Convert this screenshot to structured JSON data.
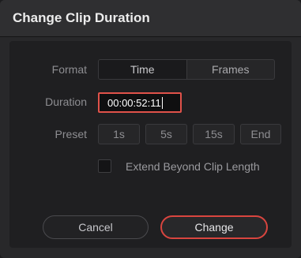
{
  "dialog": {
    "title": "Change Clip Duration",
    "format": {
      "label": "Format",
      "options": [
        "Time",
        "Frames"
      ],
      "selected": "Time"
    },
    "duration": {
      "label": "Duration",
      "value": "00:00:52:11"
    },
    "preset": {
      "label": "Preset",
      "options": [
        "1s",
        "5s",
        "15s",
        "End"
      ]
    },
    "extend": {
      "label": "Extend Beyond Clip Length",
      "checked": false
    },
    "buttons": {
      "cancel": "Cancel",
      "change": "Change"
    }
  },
  "colors": {
    "accent": "#e0524a",
    "background": "#28282a"
  }
}
